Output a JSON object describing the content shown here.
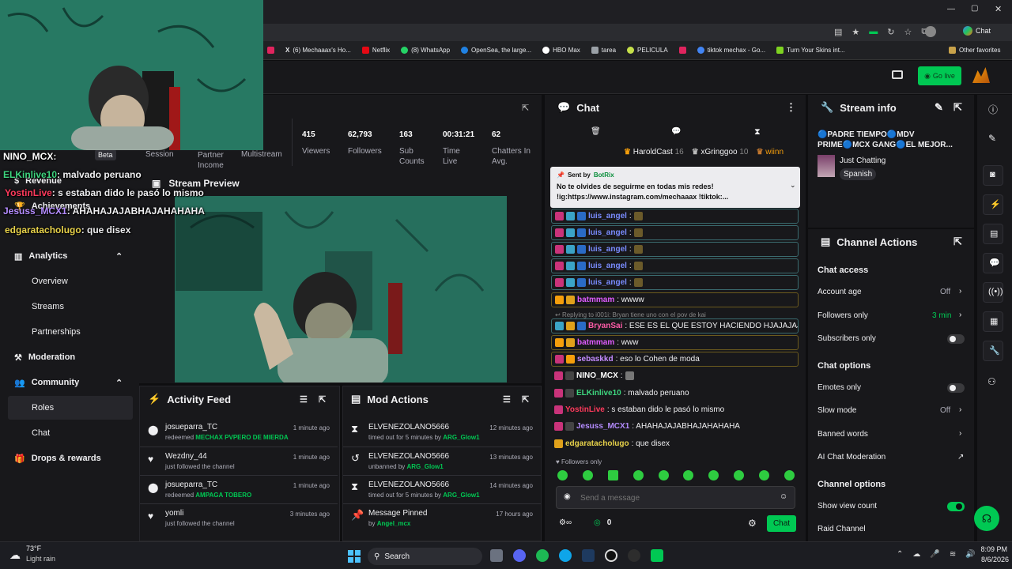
{
  "browser": {
    "profile": "Chat",
    "bookmarks": [
      "(6) Mechaaax's Ho...",
      "Netflix",
      "(8) WhatsApp",
      "OpenSea, the large...",
      "HBO Max",
      "tarea",
      "PELICULA",
      "tiktok mechax - Go...",
      "Turn Your Skins int..."
    ],
    "other_bookmarks": "Other favorites"
  },
  "topnav": {
    "go_live": "Go live"
  },
  "stats": {
    "tabs": [
      "Session",
      "Partner Income",
      "Multistream"
    ],
    "beta": "Beta",
    "items": [
      {
        "value": "415",
        "label": "Viewers"
      },
      {
        "value": "62,793",
        "label": "Followers"
      },
      {
        "value": "163",
        "label": "Sub Counts"
      },
      {
        "value": "00:31:21",
        "label": "Time Live"
      },
      {
        "value": "62",
        "label": "Chatters In Avg."
      }
    ]
  },
  "overlay_chat": [
    {
      "user": "NINO_MCX",
      "text": ":",
      "color": "#ffffff"
    },
    {
      "user": "ELKinlive10",
      "text": ": malvado peruano",
      "color": "#3ed67f"
    },
    {
      "user": "YostinLive",
      "text": ": s estaban dido le pasó lo mismo",
      "color": "#ff3a5c"
    },
    {
      "user": "Jesuss_MCX1",
      "text": ": AHAHAJAJABHAJAHAHAHA",
      "color": "#b48cff"
    },
    {
      "user": "edgaratacholugo",
      "text": ": que disex",
      "color": "#e8d24a"
    }
  ],
  "leftnav": {
    "revenue": "Revenue",
    "achievements": "Achievements",
    "analytics": "Analytics",
    "overview": "Overview",
    "streams": "Streams",
    "partnerships": "Partnerships",
    "moderation": "Moderation",
    "community": "Community",
    "roles": "Roles",
    "chat": "Chat",
    "drops": "Drops & rewards"
  },
  "preview": {
    "title": "Stream Preview"
  },
  "activity": {
    "title": "Activity Feed",
    "items": [
      {
        "user": "josueparra_TC",
        "action": "redeemed",
        "reward": "MECHAX PVPERO DE MIERDA",
        "time": "1 minute ago"
      },
      {
        "user": "Wezdny_44",
        "action": "just followed the channel",
        "reward": "",
        "time": "1 minute ago"
      },
      {
        "user": "josueparra_TC",
        "action": "redeemed",
        "reward": "AMPAGA TOBERO",
        "time": "1 minute ago"
      },
      {
        "user": "yomli",
        "action": "just followed the channel",
        "reward": "",
        "time": "3 minutes ago"
      }
    ]
  },
  "modactions": {
    "title": "Mod Actions",
    "items": [
      {
        "user": "ELVENEZOLANO5666",
        "action": "timed out for 5 minutes by",
        "by": "ARG_Glow1",
        "time": "12 minutes ago"
      },
      {
        "user": "ELVENEZOLANO5666",
        "action": "unbanned by",
        "by": "ARG_Glow1",
        "time": "13 minutes ago"
      },
      {
        "user": "ELVENEZOLANO5666",
        "action": "timed out for 5 minutes by",
        "by": "ARG_Glow1",
        "time": "14 minutes ago"
      },
      {
        "user": "Message Pinned",
        "action": "by",
        "by": "Angel_mcx",
        "time": "17 hours ago"
      }
    ]
  },
  "chat": {
    "title": "Chat",
    "top_gifters": [
      {
        "name": "HaroldCast",
        "count": "16"
      },
      {
        "name": "xGringgoo",
        "count": "10"
      },
      {
        "name": "wiinn",
        "count": ""
      }
    ],
    "pinned": {
      "sent_by": "Sent by",
      "bot": "BotRix",
      "line1": "No te olvides de seguirme en todas mis redes!",
      "line2": "!ig:https://www.instagram.com/mechaaax !tiktok:..."
    },
    "messages": [
      {
        "user": "luis_angel",
        "text": ":",
        "color": "#7a8cff",
        "style": "box"
      },
      {
        "user": "luis_angel",
        "text": ":",
        "color": "#7a8cff",
        "style": "box"
      },
      {
        "user": "luis_angel",
        "text": ":",
        "color": "#7a8cff",
        "style": "box"
      },
      {
        "user": "luis_angel",
        "text": ":",
        "color": "#7a8cff",
        "style": "box"
      },
      {
        "user": "luis_angel",
        "text": ":",
        "color": "#7a8cff",
        "style": "box"
      },
      {
        "user": "batmmam",
        "text": ": wwww",
        "color": "#e05cff",
        "style": "boxy"
      },
      {
        "user": "BryanSai",
        "text": ": ESE ES EL QUE ESTOY HACIENDO HJAJAJAJA",
        "color": "#ff5ca8",
        "style": "box"
      },
      {
        "user": "batmmam",
        "text": ": www",
        "color": "#e05cff",
        "style": "boxy"
      },
      {
        "user": "sebaskkd",
        "text": ": eso lo Cohen de moda",
        "color": "#c58cff",
        "style": "boxy"
      },
      {
        "user": "NINO_MCX",
        "text": ":",
        "color": "#ffffff",
        "style": "none"
      },
      {
        "user": "ELKinlive10",
        "text": ": malvado peruano",
        "color": "#3ed67f",
        "style": "none"
      },
      {
        "user": "YostinLive",
        "text": ": s estaban dido le pasó lo mismo",
        "color": "#ff3a5c",
        "style": "none"
      },
      {
        "user": "Jesuss_MCX1",
        "text": ": AHAHAJAJABHAJAHAHAHA",
        "color": "#b48cff",
        "style": "none"
      },
      {
        "user": "edgaratacholugo",
        "text": ": que disex",
        "color": "#e8d24a",
        "style": "none"
      }
    ],
    "reply_note": "Replying to i001i: Bryan tiene uno con el pov de kai",
    "followers_only": "Followers only",
    "input_placeholder": "Send a message",
    "points": "0",
    "send_label": "Chat"
  },
  "streaminfo": {
    "title": "Stream info",
    "stream_title": "🔵PADRE TIEMPO🔵MDV PRIME🔵MCX GANG🔵EL MEJOR...",
    "category": "Just Chatting",
    "language": "Spanish"
  },
  "channel_actions": {
    "title": "Channel Actions",
    "chat_access": "Chat access",
    "account_age": "Account age",
    "account_age_val": "Off",
    "followers_only": "Followers only",
    "followers_only_val": "3 min",
    "subscribers_only": "Subscribers only",
    "chat_options": "Chat options",
    "emotes_only": "Emotes only",
    "slow_mode": "Slow mode",
    "slow_mode_val": "Off",
    "banned_words": "Banned words",
    "ai_moderation": "AI Chat Moderation",
    "channel_options": "Channel options",
    "show_view_count": "Show view count",
    "raid_channel": "Raid Channel"
  },
  "taskbar": {
    "temp": "73°F",
    "weather": "Light rain",
    "search": "Search",
    "time": "8:09 PM",
    "date": "8/6/2026"
  },
  "colors": {
    "accent": "#00c853",
    "bg": "#0e0e10",
    "panel": "#18181b"
  }
}
